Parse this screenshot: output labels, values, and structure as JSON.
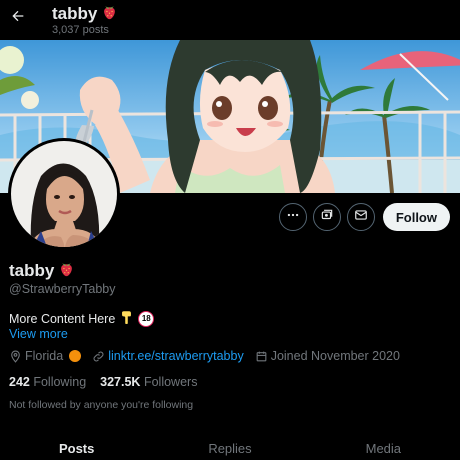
{
  "header": {
    "back_icon": "arrow-left-icon",
    "name": "tabby",
    "name_emoji": "strawberry",
    "posts_count": "3,037 posts"
  },
  "profile": {
    "display_name": "tabby",
    "handle": "@StrawberryTabby",
    "bio_text": "More Content Here",
    "bio_emoji": "pointing-down-hand",
    "age_badge": "18",
    "view_more": "View more",
    "location": "Florida",
    "link": "linktr.ee/strawberrytabby",
    "joined": "Joined November 2020"
  },
  "actions": {
    "follow_label": "Follow",
    "icons": [
      "more-icon",
      "subscribe-icon",
      "message-icon"
    ]
  },
  "stats": {
    "following_count": "242",
    "following_label": "Following",
    "followers_count": "327.5K",
    "followers_label": "Followers"
  },
  "social_context": "Not followed by anyone you're following",
  "tabs": [
    {
      "label": "Posts",
      "active": true
    },
    {
      "label": "Replies",
      "active": false
    },
    {
      "label": "Media",
      "active": false
    }
  ],
  "colors": {
    "background": "#000000",
    "primary_text": "#e7e9ea",
    "secondary_text": "#71767b",
    "link": "#1d9bf0",
    "follow_button": "#eff3f4"
  }
}
